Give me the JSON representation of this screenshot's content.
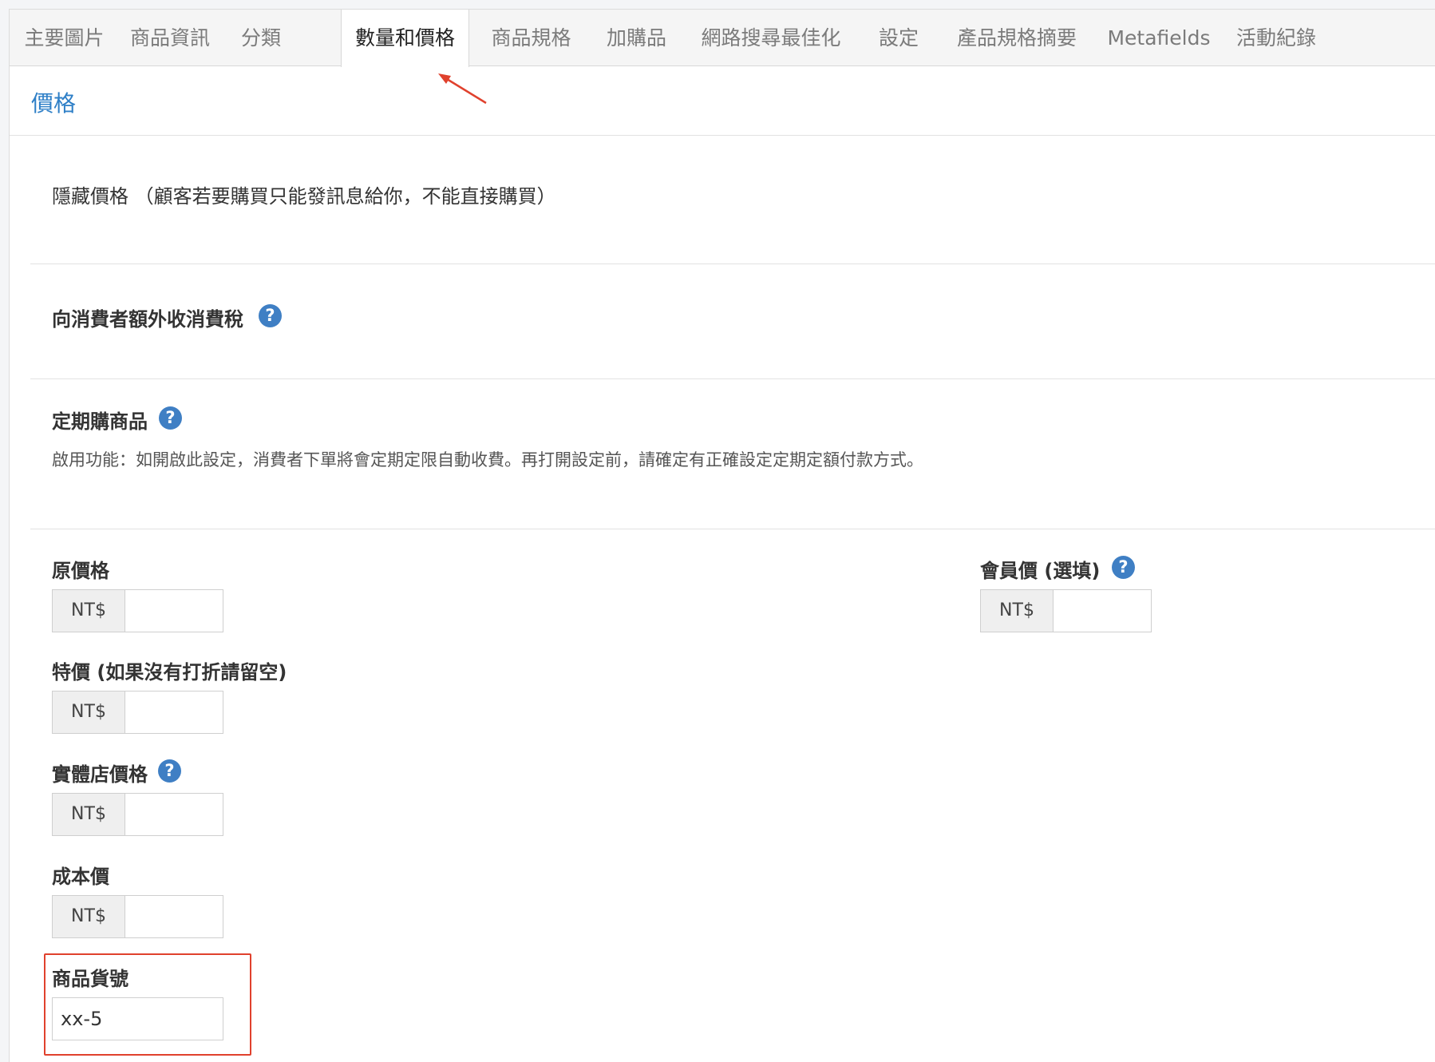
{
  "tabs": [
    {
      "label": "主要圖片"
    },
    {
      "label": "商品資訊"
    },
    {
      "label": "分類"
    },
    {
      "label": "數量和價格"
    },
    {
      "label": "商品規格"
    },
    {
      "label": "加購品"
    },
    {
      "label": "網路搜尋最佳化"
    },
    {
      "label": "設定"
    },
    {
      "label": "產品規格摘要"
    },
    {
      "label": "Metafields"
    },
    {
      "label": "活動紀錄"
    }
  ],
  "active_tab": "數量和價格",
  "section": {
    "title": "價格"
  },
  "hide_price": {
    "label": "隱藏價格 （顧客若要購買只能發訊息給你，不能直接購買）"
  },
  "tax": {
    "label": "向消費者額外收消費稅",
    "help_icon": "question-circle-icon"
  },
  "subscription": {
    "label": "定期購商品",
    "help_icon": "question-circle-icon",
    "description": "啟用功能：如開啟此設定，消費者下單將會定期定限自動收費。再打開設定前，請確定有正確設定定期定額付款方式。"
  },
  "currency": "NT$",
  "help_glyph": "?",
  "fields": {
    "original_price": {
      "label": "原價格",
      "value": ""
    },
    "member_price": {
      "label": "會員價 (選填)",
      "value": ""
    },
    "sale_price": {
      "label": "特價 (如果沒有打折請留空)",
      "value": ""
    },
    "retail_price": {
      "label": "實體店價格",
      "value": ""
    },
    "cost_price": {
      "label": "成本價",
      "value": ""
    },
    "sku": {
      "label": "商品貨號",
      "value": "xx-5"
    }
  },
  "colors": {
    "accent": "#2e7fc7",
    "help_icon": "#3f7fc4",
    "highlight": "#e0412d"
  }
}
